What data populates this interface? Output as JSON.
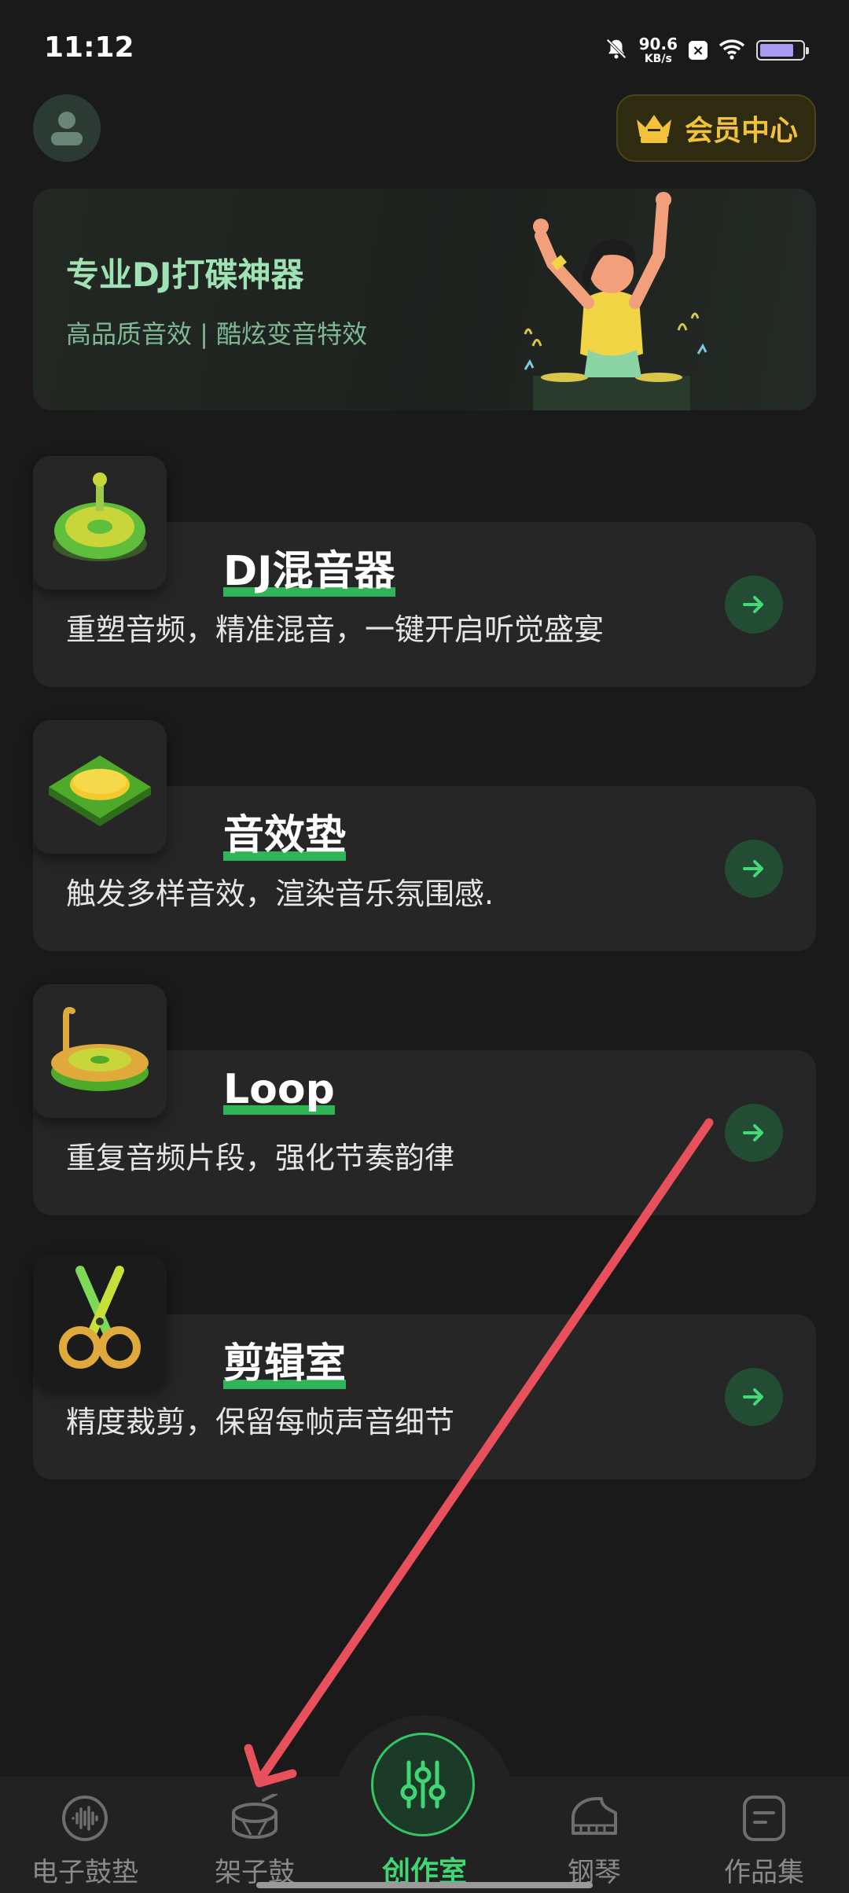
{
  "status": {
    "time": "11:12",
    "net_speed_value": "90.6",
    "net_speed_unit": "KB/s",
    "badge": "×",
    "battery_level": 0.8
  },
  "header": {
    "vip_label": "会员中心"
  },
  "banner": {
    "title": "专业DJ打碟神器",
    "subtitle": "高品质音效 | 酷炫变音特效"
  },
  "cards": [
    {
      "title": "DJ混音器",
      "desc": "重塑音频，精准混音，一键开启听觉盛宴"
    },
    {
      "title": "音效垫",
      "desc": "触发多样音效，渲染音乐氛围感."
    },
    {
      "title": "Loop",
      "desc": "重复音频片段，强化节奏韵律"
    },
    {
      "title": "剪辑室",
      "desc": "精度裁剪，保留每帧声音细节"
    }
  ],
  "tabs": [
    {
      "label": "电子鼓垫",
      "icon": "waveform-icon"
    },
    {
      "label": "架子鼓",
      "icon": "drum-icon"
    },
    {
      "label": "创作室",
      "icon": "sliders-icon",
      "active": true
    },
    {
      "label": "钢琴",
      "icon": "piano-icon"
    },
    {
      "label": "作品集",
      "icon": "document-icon"
    }
  ],
  "colors": {
    "accent": "#3fd673",
    "vip_gold": "#f1c23a",
    "background": "#1a1a1a",
    "annotation_arrow": "#e8505b"
  }
}
